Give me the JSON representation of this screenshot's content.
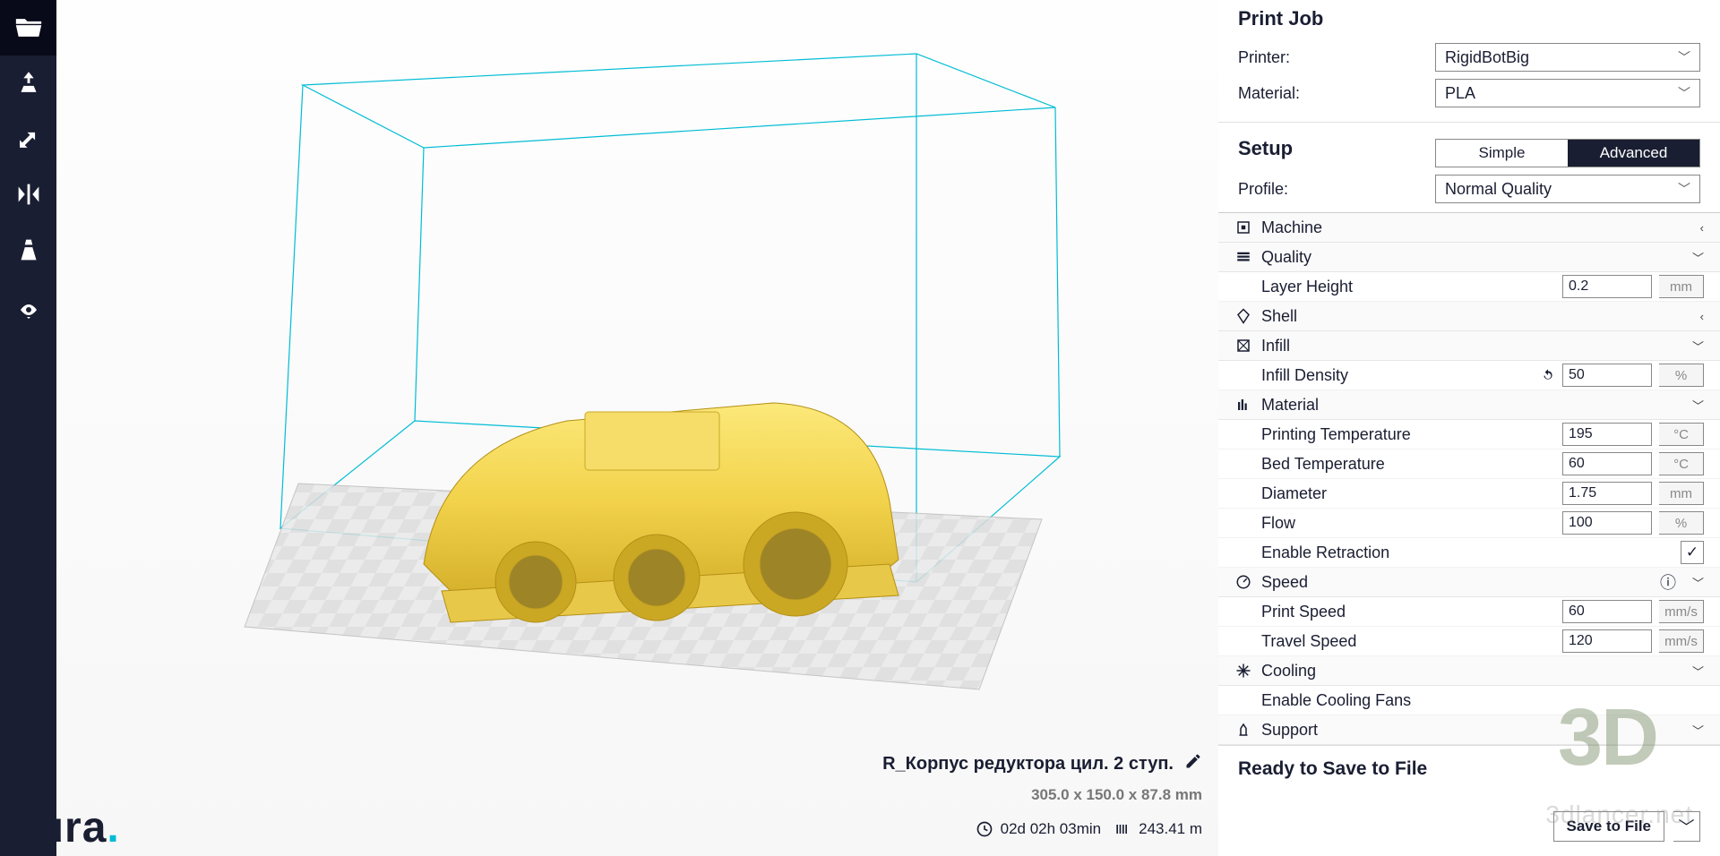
{
  "toolbar": {
    "icons": [
      "open-file",
      "rotate",
      "scale",
      "mirror",
      "solidview",
      "eye"
    ]
  },
  "object": {
    "name": "R_Корпус редуктора цил. 2 ступ.",
    "dims": "305.0 x 150.0 x 87.8 mm",
    "time": "02d 02h 03min",
    "length": "243.41 m"
  },
  "logo": {
    "text": "cura",
    "dot": "."
  },
  "panel": {
    "printJob": {
      "title": "Print Job",
      "printerLabel": "Printer:",
      "printer": "RigidBotBig",
      "materialLabel": "Material:",
      "material": "PLA"
    },
    "setup": {
      "title": "Setup",
      "simple": "Simple",
      "advanced": "Advanced",
      "profileLabel": "Profile:",
      "profile": "Normal Quality"
    },
    "cats": {
      "machine": "Machine",
      "quality": "Quality",
      "shell": "Shell",
      "infill": "Infill",
      "material": "Material",
      "speed": "Speed",
      "cooling": "Cooling",
      "support": "Support"
    },
    "fields": {
      "layerHeight": {
        "label": "Layer Height",
        "value": "0.2",
        "unit": "mm"
      },
      "infillDensity": {
        "label": "Infill Density",
        "value": "50",
        "unit": "%"
      },
      "printTemp": {
        "label": "Printing Temperature",
        "value": "195",
        "unit": "°C"
      },
      "bedTemp": {
        "label": "Bed Temperature",
        "value": "60",
        "unit": "°C"
      },
      "diameter": {
        "label": "Diameter",
        "value": "1.75",
        "unit": "mm"
      },
      "flow": {
        "label": "Flow",
        "value": "100",
        "unit": "%"
      },
      "enableRetraction": {
        "label": "Enable Retraction",
        "checked": "✓"
      },
      "printSpeed": {
        "label": "Print Speed",
        "value": "60",
        "unit": "mm/s"
      },
      "travelSpeed": {
        "label": "Travel Speed",
        "value": "120",
        "unit": "mm/s"
      },
      "enableFans": {
        "label": "Enable Cooling Fans"
      }
    },
    "ready": "Ready to Save to File",
    "save": "Save to File"
  },
  "watermark": {
    "big": "3D",
    "small": "3dlancer.net"
  }
}
